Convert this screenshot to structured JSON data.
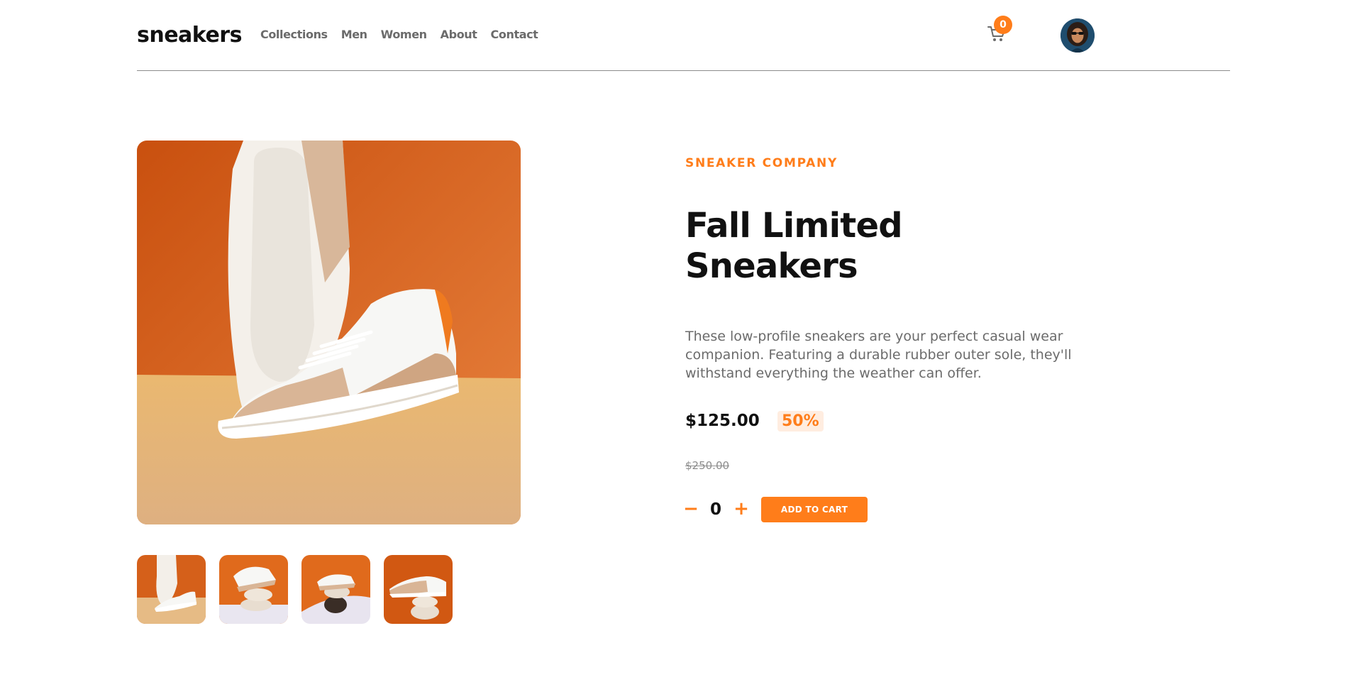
{
  "header": {
    "logo": "sneakers",
    "nav": [
      "Collections",
      "Men",
      "Women",
      "About",
      "Contact"
    ],
    "cart_count": "0"
  },
  "product": {
    "company": "SNEAKER COMPANY",
    "title": "Fall Limited Sneakers",
    "description": "These low-profile sneakers are your perfect casual wear companion. Featuring a durable rubber outer sole, they'll withstand everything the weather can offer.",
    "price": "$125.00",
    "discount": "50%",
    "old_price": "$250.00",
    "quantity": "0",
    "qty_minus": "−",
    "qty_plus": "+",
    "add_to_cart": "ADD TO CART"
  },
  "colors": {
    "accent": "#ff7d1a",
    "accent_pale": "#ffede0",
    "text_dark": "#111111",
    "text_gray": "#6b6b6b"
  },
  "icons": {
    "cart": "cart-icon",
    "avatar": "avatar"
  }
}
